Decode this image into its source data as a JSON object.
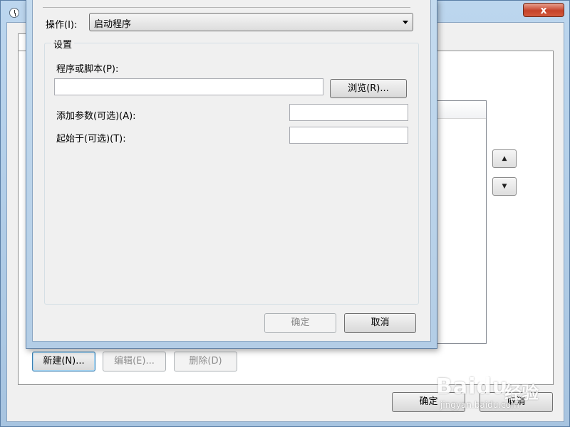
{
  "background_window": {
    "close_glyph": "x",
    "buttons": {
      "new": "新建(N)...",
      "edit": "编辑(E)...",
      "delete": "删除(D)",
      "ok": "确定",
      "cancel": "取消"
    },
    "move_up_glyph": "▲",
    "move_down_glyph": "▼"
  },
  "dialog": {
    "action_label": "操作(I):",
    "action_value": "启动程序",
    "settings_group_title": "设置",
    "program_label": "程序或脚本(P):",
    "program_value": "",
    "browse_button": "浏览(R)...",
    "arguments_label": "添加参数(可选)(A):",
    "arguments_value": "",
    "start_in_label": "起始于(可选)(T):",
    "start_in_value": "",
    "ok_button": "确定",
    "cancel_button": "取消"
  },
  "watermark": {
    "logo": "Baidu",
    "logo_cn": "经验",
    "url": "jingyan.baidu.com"
  },
  "colors": {
    "window_frame": "#a9c7e2",
    "dialog_background": "#f0f0f0",
    "close_button": "#c5432a"
  }
}
